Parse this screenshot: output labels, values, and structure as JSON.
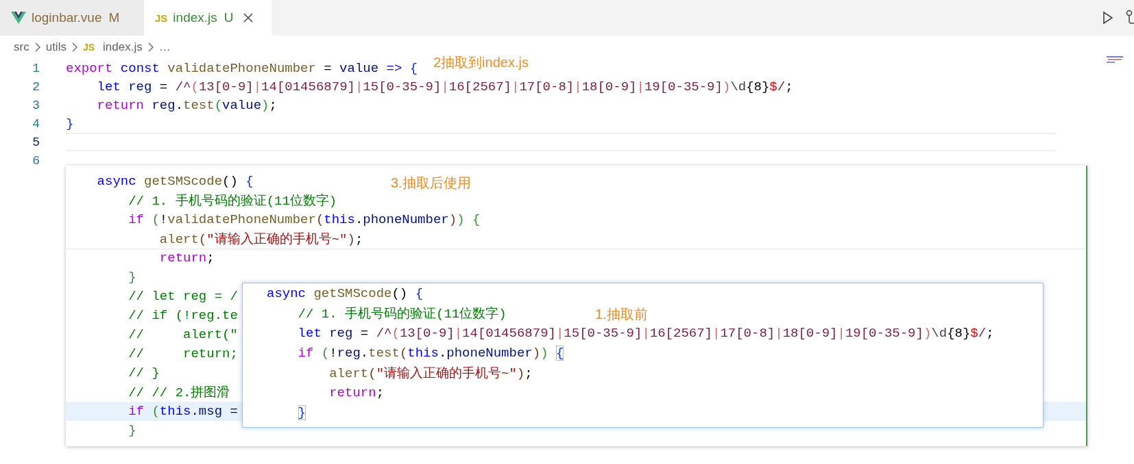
{
  "tabs": [
    {
      "label": "loginbar.vue",
      "badge": "M",
      "color": "#8c6c3e",
      "icon": {
        "kind": "vue"
      },
      "selected": false,
      "closable": false
    },
    {
      "label": "index.js",
      "badge": "U",
      "color": "#388a34",
      "icon": {
        "kind": "text",
        "text": "JS"
      },
      "selected": true,
      "closable": true
    }
  ],
  "breadcrumbs": [
    {
      "label": "src"
    },
    {
      "label": "utils"
    },
    {
      "label": "index.js",
      "icon_text": "JS"
    },
    {
      "label": "…"
    }
  ],
  "editor": {
    "lines": [
      {
        "number": "1",
        "current": false,
        "tokens": [
          {
            "text": "export ",
            "kind": "ctrl"
          },
          {
            "text": "const ",
            "kind": "decl"
          },
          {
            "text": "validatePhoneNumber",
            "kind": "fn"
          },
          {
            "text": " = ",
            "kind": "p"
          },
          {
            "text": "value",
            "kind": "var"
          },
          {
            "text": " => ",
            "kind": "decl"
          },
          {
            "text": "{",
            "kind": "b1"
          }
        ]
      },
      {
        "number": "2",
        "current": false,
        "tokens": [
          {
            "text": "    let ",
            "kind": "decl"
          },
          {
            "text": "reg",
            "kind": "var"
          },
          {
            "text": " = ",
            "kind": "p"
          },
          {
            "text": "/^",
            "kind": "re"
          },
          {
            "text": "(",
            "kind": "reop"
          },
          {
            "text": "13[0-9]",
            "kind": "re"
          },
          {
            "text": "|",
            "kind": "reop"
          },
          {
            "text": "14[01456879]",
            "kind": "re"
          },
          {
            "text": "|",
            "kind": "reop"
          },
          {
            "text": "15[0-35-9]",
            "kind": "re"
          },
          {
            "text": "|",
            "kind": "reop"
          },
          {
            "text": "16[2567]",
            "kind": "re"
          },
          {
            "text": "|",
            "kind": "reop"
          },
          {
            "text": "17[0-8]",
            "kind": "re"
          },
          {
            "text": "|",
            "kind": "reop"
          },
          {
            "text": "18[0-9]",
            "kind": "re"
          },
          {
            "text": "|",
            "kind": "reop"
          },
          {
            "text": "19[0-35-9]",
            "kind": "re"
          },
          {
            "text": ")",
            "kind": "reop"
          },
          {
            "text": "\\d",
            "kind": "reesc"
          },
          {
            "text": "{8}",
            "kind": "p"
          },
          {
            "text": "$",
            "kind": "dol"
          },
          {
            "text": "/",
            "kind": "re"
          },
          {
            "text": ";",
            "kind": "p"
          }
        ]
      },
      {
        "number": "3",
        "current": false,
        "tokens": [
          {
            "text": "    return ",
            "kind": "ctrl"
          },
          {
            "text": "reg",
            "kind": "var"
          },
          {
            "text": ".",
            "kind": "p"
          },
          {
            "text": "test",
            "kind": "fn"
          },
          {
            "text": "(",
            "kind": "b2"
          },
          {
            "text": "value",
            "kind": "var"
          },
          {
            "text": ")",
            "kind": "b2"
          },
          {
            "text": ";",
            "kind": "p"
          }
        ]
      },
      {
        "number": "4",
        "current": false,
        "tokens": [
          {
            "text": "}",
            "kind": "b1"
          }
        ]
      },
      {
        "number": "5",
        "current": true
      },
      {
        "number": "6",
        "current": false
      }
    ]
  },
  "snippets": [
    {
      "lines": [
        {
          "current": false,
          "tokens": [
            {
              "text": "    async ",
              "kind": "decl"
            },
            {
              "text": "getSMScode",
              "kind": "fn"
            },
            {
              "text": "() ",
              "kind": "p"
            },
            {
              "text": "{",
              "kind": "b1"
            }
          ]
        },
        {
          "current": false,
          "tokens": [
            {
              "text": "        // 1. 手机号码的验证(11位数字)",
              "kind": "cmt"
            }
          ]
        },
        {
          "current": false,
          "tokens": [
            {
              "text": "        if ",
              "kind": "ctrl"
            },
            {
              "text": "(",
              "kind": "b2"
            },
            {
              "text": "!",
              "kind": "p"
            },
            {
              "text": "validatePhoneNumber",
              "kind": "fn"
            },
            {
              "text": "(",
              "kind": "b3"
            },
            {
              "text": "this",
              "kind": "decl"
            },
            {
              "text": ".",
              "kind": "p"
            },
            {
              "text": "phoneNumber",
              "kind": "var"
            },
            {
              "text": ")",
              "kind": "b3"
            },
            {
              "text": ") ",
              "kind": "b2"
            },
            {
              "text": "{",
              "kind": "b2"
            }
          ]
        },
        {
          "current": false,
          "tokens": [
            {
              "text": "            alert",
              "kind": "fn"
            },
            {
              "text": "(",
              "kind": "b3"
            },
            {
              "text": "\"请输入正确的手机号~\"",
              "kind": "str"
            },
            {
              "text": ")",
              "kind": "b3"
            },
            {
              "text": ";",
              "kind": "p"
            }
          ]
        },
        {
          "current": false,
          "tokens": [
            {
              "text": "            return",
              "kind": "ctrl"
            },
            {
              "text": ";",
              "kind": "p"
            }
          ]
        },
        {
          "current": false,
          "tokens": [
            {
              "text": "        }",
              "kind": "b2"
            }
          ]
        },
        {
          "current": false,
          "tokens": [
            {
              "text": "        // let reg = /",
              "kind": "cmt"
            }
          ]
        },
        {
          "current": false,
          "tokens": [
            {
              "text": "        // if (!reg.te",
              "kind": "cmt"
            }
          ]
        },
        {
          "current": false,
          "tokens": [
            {
              "text": "        //     alert(\"",
              "kind": "cmt"
            }
          ]
        },
        {
          "current": false,
          "tokens": [
            {
              "text": "        //     return;",
              "kind": "cmt"
            }
          ]
        },
        {
          "current": false,
          "tokens": [
            {
              "text": "        // }",
              "kind": "cmt"
            }
          ]
        },
        {
          "current": false,
          "tokens": [
            {
              "text": "        // // 2.拼图滑",
              "kind": "cmt"
            }
          ]
        },
        {
          "current": true,
          "tokens": [
            {
              "text": "        if ",
              "kind": "ctrl"
            },
            {
              "text": "(",
              "kind": "b2"
            },
            {
              "text": "this",
              "kind": "decl"
            },
            {
              "text": ".",
              "kind": "p"
            },
            {
              "text": "msg",
              "kind": "var"
            },
            {
              "text": " =",
              "kind": "p"
            }
          ]
        },
        {
          "current": false,
          "tokens": [
            {
              "text": "        }",
              "kind": "b2"
            }
          ]
        }
      ]
    },
    {
      "lines": [
        {
          "current": false,
          "tokens": [
            {
              "text": "async ",
              "kind": "decl"
            },
            {
              "text": "getSMScode",
              "kind": "fn"
            },
            {
              "text": "() ",
              "kind": "p"
            },
            {
              "text": "{",
              "kind": "b1"
            }
          ]
        },
        {
          "current": false,
          "tokens": [
            {
              "text": "    // 1. 手机号码的验证(11位数字)",
              "kind": "cmt"
            }
          ]
        },
        {
          "current": false,
          "tokens": [
            {
              "text": "    let ",
              "kind": "decl"
            },
            {
              "text": "reg",
              "kind": "var"
            },
            {
              "text": " = ",
              "kind": "p"
            },
            {
              "text": "/^",
              "kind": "re"
            },
            {
              "text": "(",
              "kind": "reop"
            },
            {
              "text": "13[0-9]",
              "kind": "re"
            },
            {
              "text": "|",
              "kind": "reop"
            },
            {
              "text": "14[01456879]",
              "kind": "re"
            },
            {
              "text": "|",
              "kind": "reop"
            },
            {
              "text": "15[0-35-9]",
              "kind": "re"
            },
            {
              "text": "|",
              "kind": "reop"
            },
            {
              "text": "16[2567]",
              "kind": "re"
            },
            {
              "text": "|",
              "kind": "reop"
            },
            {
              "text": "17[0-8]",
              "kind": "re"
            },
            {
              "text": "|",
              "kind": "reop"
            },
            {
              "text": "18[0-9]",
              "kind": "re"
            },
            {
              "text": "|",
              "kind": "reop"
            },
            {
              "text": "19[0-35-9]",
              "kind": "re"
            },
            {
              "text": ")",
              "kind": "reop"
            },
            {
              "text": "\\d",
              "kind": "reesc"
            },
            {
              "text": "{8}",
              "kind": "p"
            },
            {
              "text": "$",
              "kind": "dol"
            },
            {
              "text": "/",
              "kind": "re"
            },
            {
              "text": ";",
              "kind": "p"
            }
          ]
        },
        {
          "current": false,
          "tokens": [
            {
              "text": "    if ",
              "kind": "ctrl"
            },
            {
              "text": "(",
              "kind": "b2"
            },
            {
              "text": "!",
              "kind": "p"
            },
            {
              "text": "reg",
              "kind": "var"
            },
            {
              "text": ".",
              "kind": "p"
            },
            {
              "text": "test",
              "kind": "fn"
            },
            {
              "text": "(",
              "kind": "b3"
            },
            {
              "text": "this",
              "kind": "decl"
            },
            {
              "text": ".",
              "kind": "p"
            },
            {
              "text": "phoneNumber",
              "kind": "var"
            },
            {
              "text": ")",
              "kind": "b3"
            },
            {
              "text": ") ",
              "kind": "b2"
            },
            {
              "text": "{",
              "kind": "bm"
            }
          ]
        },
        {
          "current": false,
          "tokens": [
            {
              "text": "        alert",
              "kind": "fn"
            },
            {
              "text": "(",
              "kind": "b3"
            },
            {
              "text": "\"请输入正确的手机号~\"",
              "kind": "str"
            },
            {
              "text": ")",
              "kind": "b3"
            },
            {
              "text": ";",
              "kind": "p"
            }
          ]
        },
        {
          "current": false,
          "tokens": [
            {
              "text": "        return",
              "kind": "ctrl"
            },
            {
              "text": ";",
              "kind": "p"
            }
          ]
        },
        {
          "current": false,
          "tokens": [
            {
              "text": "    }",
              "kind": "bm"
            }
          ]
        }
      ]
    }
  ],
  "annotations": [
    {
      "text": "2抽取到index.js"
    },
    {
      "text": "3.抽取后使用"
    },
    {
      "text": "1.抽取前"
    }
  ]
}
